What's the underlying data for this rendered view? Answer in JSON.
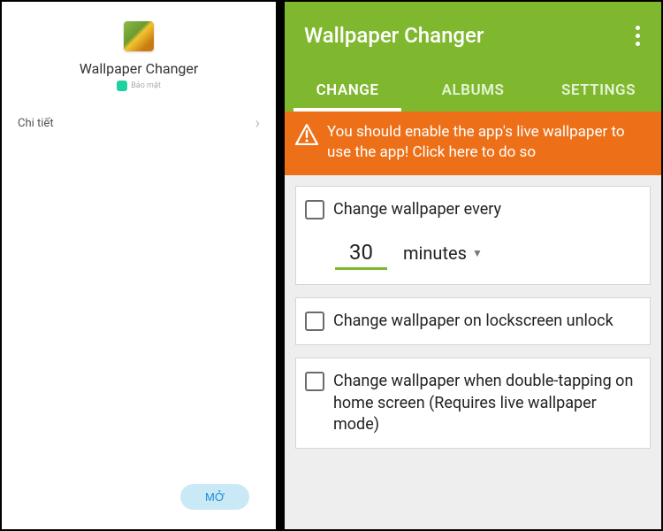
{
  "left": {
    "app_title": "Wallpaper Changer",
    "badge_text": "Bảo mật",
    "detail_label": "Chi tiết",
    "open_button": "MỞ"
  },
  "app": {
    "title": "Wallpaper Changer",
    "tabs": {
      "change": "CHANGE",
      "albums": "ALBUMS",
      "settings": "SETTINGS"
    },
    "banner": "You should enable the app's live wallpaper to use the app! Click here to do so",
    "options": {
      "every": "Change wallpaper every",
      "interval_value": "30",
      "interval_unit": "minutes",
      "lockscreen": "Change wallpaper on lockscreen unlock",
      "doubletap": "Change wallpaper when double-tapping on home screen (Requires live wallpaper mode)"
    }
  }
}
